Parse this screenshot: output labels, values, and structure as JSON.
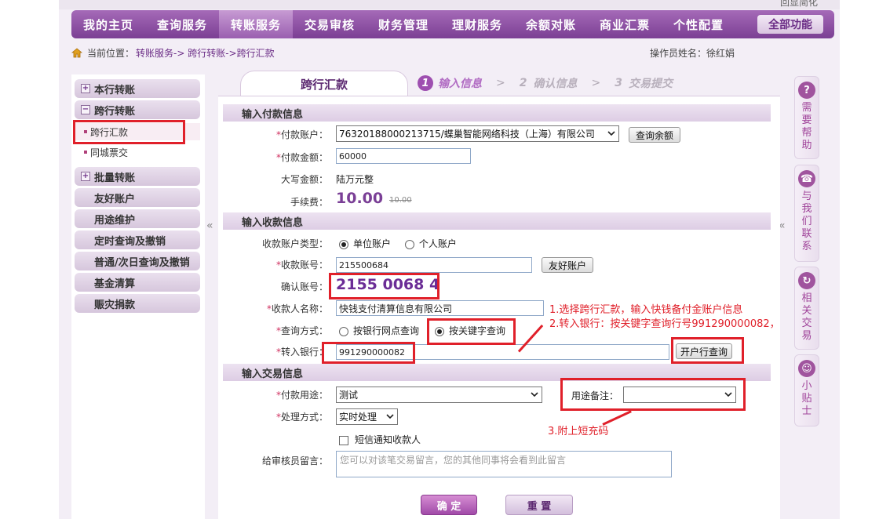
{
  "top_link": "回显简化",
  "nav": {
    "items": [
      "我的主页",
      "查询服务",
      "转账服务",
      "交易审核",
      "财务管理",
      "理财服务",
      "余额对账",
      "商业汇票",
      "个性配置"
    ],
    "all_label": "全部功能"
  },
  "breadcrumb": {
    "prefix": "当前位置：",
    "path": "转账服务-> 跨行转账->跨行汇款"
  },
  "operator": "操作员姓名：徐红娟",
  "sidebar": {
    "groups": [
      {
        "label": "本行转账",
        "symbol": "+"
      },
      {
        "label": "跨行转账",
        "symbol": "−"
      }
    ],
    "sub_items": [
      "跨行汇款",
      "同城票交"
    ],
    "more": [
      {
        "label": "批量转账",
        "symbol": "+"
      },
      {
        "label": "友好账户"
      },
      {
        "label": "用途维护"
      },
      {
        "label": "定时查询及撤销"
      },
      {
        "label": "普通/次日查询及撤销"
      },
      {
        "label": "基金清算"
      },
      {
        "label": "赈灾捐款"
      }
    ]
  },
  "collapse_glyph": "«",
  "rail": [
    {
      "icon": "?",
      "text": "需要帮助"
    },
    {
      "icon": "☎",
      "text": "与我们联系"
    },
    {
      "icon": "↻",
      "text": "相关交易"
    },
    {
      "icon": "☺",
      "text": "小贴士"
    }
  ],
  "tab_title": "跨行汇款",
  "steps": [
    {
      "num": "1",
      "label": "输入信息",
      "active": true
    },
    {
      "num": "2",
      "label": "确认信息",
      "active": false
    },
    {
      "num": "3",
      "label": "交易提交",
      "active": false
    }
  ],
  "step_sep": ">",
  "sections": {
    "payer": "输入付款信息",
    "payee": "输入收款信息",
    "trade": "输入交易信息"
  },
  "payer": {
    "account_label": "付款账户：",
    "account_value": "76320188000213715/蝶巢智能网络科技（上海）有限公司",
    "balance_btn": "查询余额",
    "amount_label": "付款金额：",
    "amount_value": "60000",
    "capital_label": "大写金额：",
    "capital_value": "陆万元整",
    "fee_label": "手续费：",
    "fee_value": "10.00",
    "fee_old": "10.00"
  },
  "payee": {
    "type_label": "收款账户类型：",
    "type_options": [
      "单位账户",
      "个人账户"
    ],
    "account_label": "收款账号：",
    "account_value": "215500684",
    "friend_btn": "友好账户",
    "confirm_label": "确认账号：",
    "confirm_value": "2155 0068 4",
    "name_label": "收款人名称：",
    "name_value": "快钱支付清算信息有限公司",
    "query_label": "查询方式：",
    "query_options": [
      "按银行网点查询",
      "按关键字查询"
    ],
    "bank_label": "转入银行：",
    "bank_value": "991290000082",
    "bank_btn": "开户行查询"
  },
  "trade": {
    "purpose_label": "付款用途：",
    "purpose_value": "测试",
    "remark_label": "用途备注：",
    "method_label": "处理方式：",
    "method_value": "实时处理",
    "sms_label": "短信通知收款人",
    "msg_label": "给审核员留言：",
    "msg_placeholder": "您可以对该笔交易留言，您的其他同事将会看到此留言"
  },
  "buttons": {
    "ok": "确 定",
    "reset": "重 置"
  },
  "annotations": {
    "note1": "1.选择跨行汇款，输入快钱备付金账户信息",
    "note2": "2.转入银行：按关键字查询行号991290000082，",
    "note3": "3.附上短充码"
  },
  "colors": {
    "nav": "#7b3f94",
    "accent": "#9e4fb0",
    "annotation": "#e0202a"
  }
}
